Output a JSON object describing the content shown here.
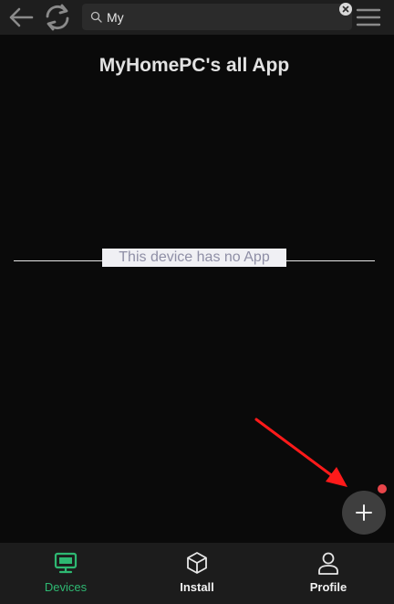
{
  "search": {
    "value": "My"
  },
  "page": {
    "title": "MyHomePC's all App",
    "empty_message": "This device has no App"
  },
  "colors": {
    "accent": "#2eb872",
    "badge": "#e8454a",
    "annotation_arrow": "#ff1a1a"
  },
  "icons": {
    "back": "back-arrow-icon",
    "refresh": "refresh-icon",
    "search": "search-icon",
    "clear": "clear-icon",
    "menu": "hamburger-menu-icon",
    "add": "plus-icon",
    "devices": "monitor-icon",
    "install": "cube-icon",
    "profile": "person-icon"
  },
  "bottom_nav": {
    "items": [
      {
        "label": "Devices",
        "active": true
      },
      {
        "label": "Install",
        "active": false
      },
      {
        "label": "Profile",
        "active": false
      }
    ]
  }
}
